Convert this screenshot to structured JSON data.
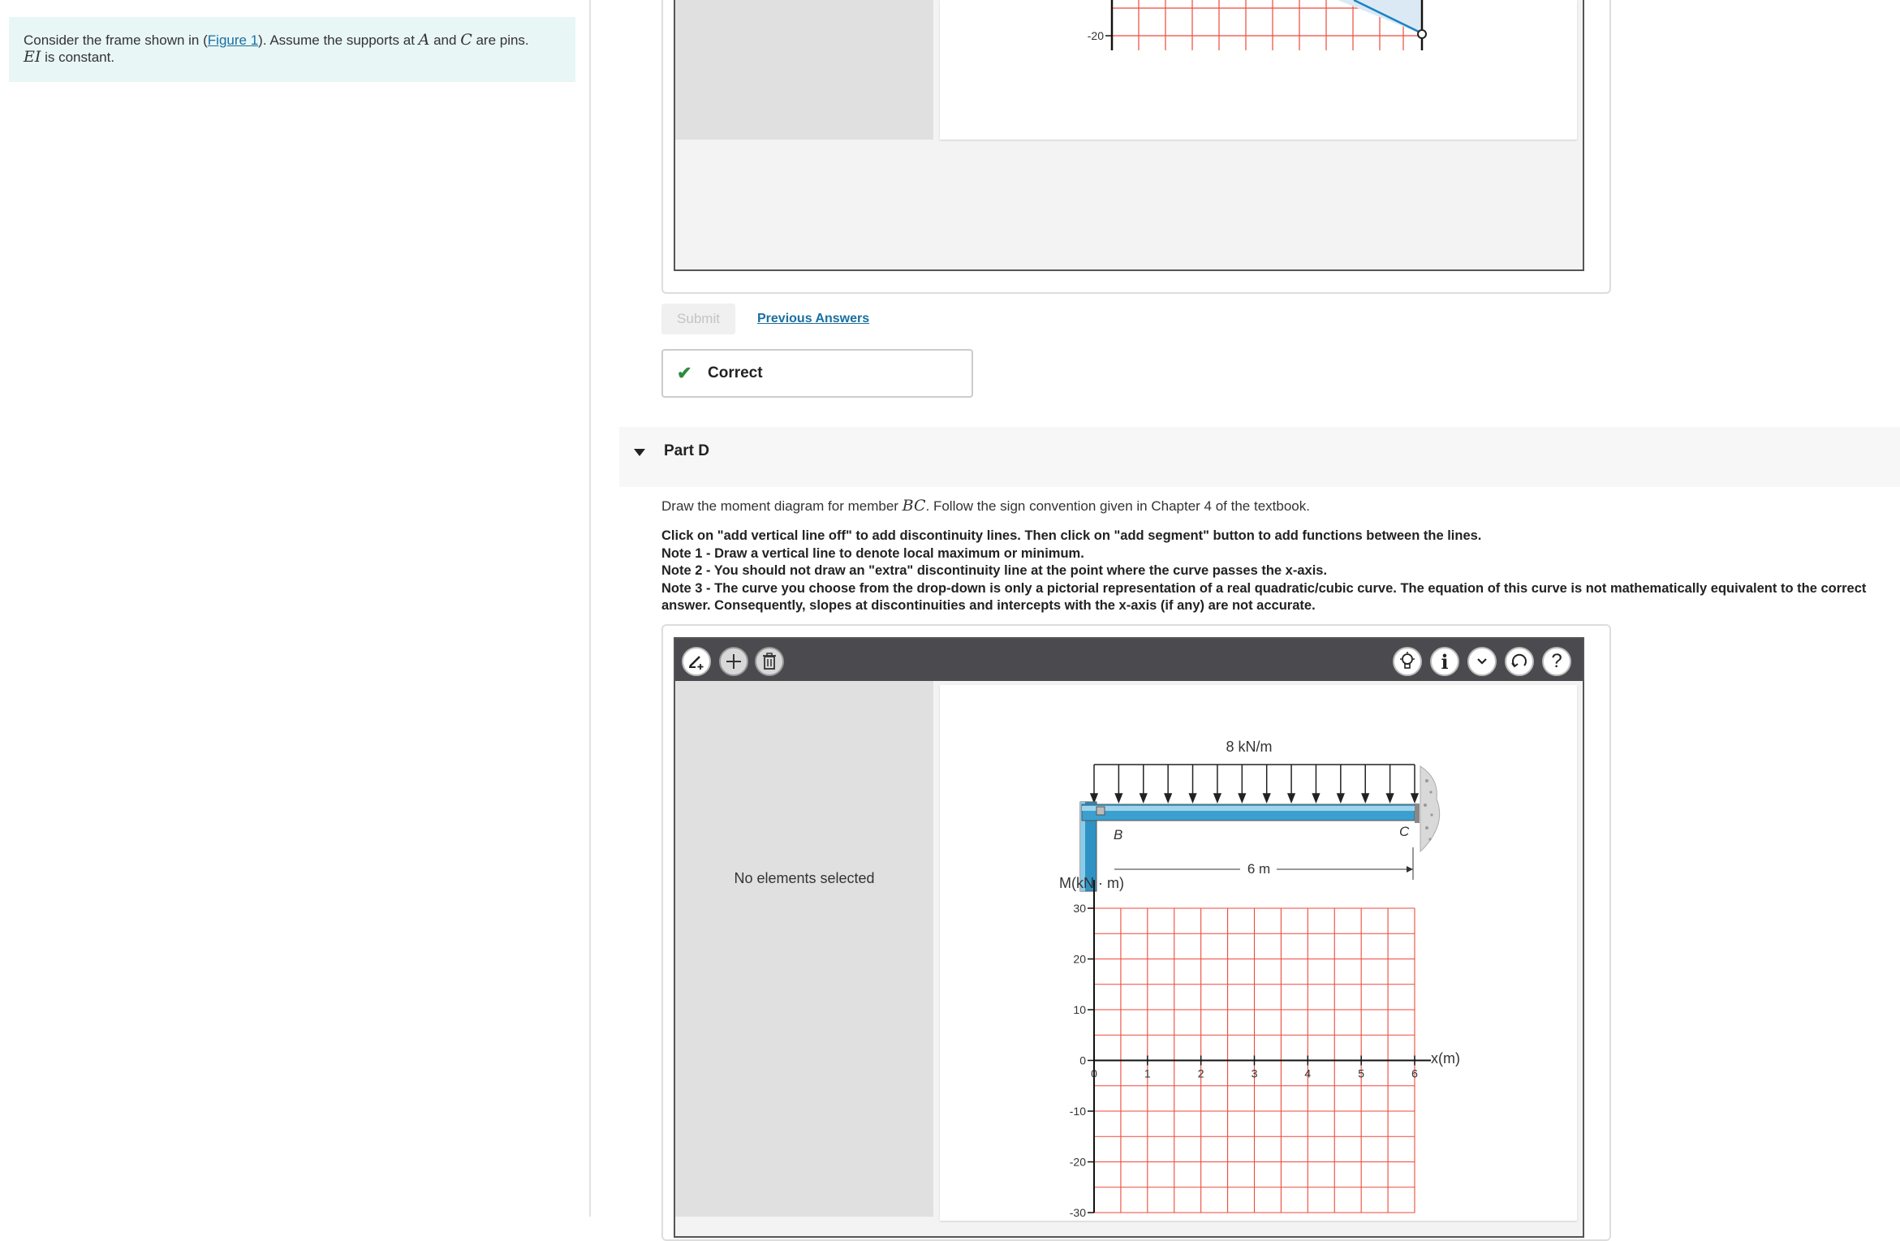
{
  "problem": {
    "text_before": "Consider the frame shown in (",
    "figure_link": "Figure 1",
    "text_mid": "). Assume the supports at ",
    "var_a": "A",
    "text_and": " and ",
    "var_c": "C",
    "text_after": " are pins.",
    "var_ei": "EI",
    "text_const": " is constant."
  },
  "top_graph": {
    "tick_label": "-20"
  },
  "actions": {
    "submit_label": "Submit",
    "previous_answers_label": "Previous Answers"
  },
  "feedback": {
    "label": "Correct"
  },
  "part_d": {
    "title": "Part D",
    "instruction_before": "Draw the moment diagram for member ",
    "member": "BC",
    "instruction_after": ". Follow the sign convention given in Chapter 4 of the textbook.",
    "notes": [
      "Click on \"add vertical line off\" to add discontinuity lines. Then click on \"add segment\" button to add functions between the lines.",
      "Note 1 - Draw a vertical line to denote local maximum or minimum.",
      "Note 2 - You should not draw an \"extra\" discontinuity line at the point where the curve passes the x-axis.",
      "Note 3 - The curve you choose from the drop-down is only a pictorial representation of a real quadratic/cubic curve. The equation of this curve is not mathematically equivalent to the correct answer. Consequently, slopes at discontinuities and intercepts with the x-axis (if any) are not accurate."
    ]
  },
  "toolbar": {
    "left_icons": [
      "add-vertical-line-icon",
      "add-segment-icon",
      "delete-icon"
    ],
    "right_icons": [
      "hint-bulb-icon",
      "info-icon",
      "dropdown-chevron-icon",
      "reset-icon",
      "help-icon"
    ]
  },
  "side_panel": {
    "empty_label": "No elements selected"
  },
  "figure": {
    "load_label": "8 kN/m",
    "span_label": "6 m",
    "point_b": "B",
    "point_c": "C"
  },
  "chart_data": {
    "type": "line",
    "title": "",
    "ylabel": "M(kN · m)",
    "xlabel": "x(m)",
    "xlim": [
      0,
      6
    ],
    "ylim": [
      -30,
      30
    ],
    "x_ticks": [
      "0",
      "1",
      "2",
      "3",
      "4",
      "5",
      "6"
    ],
    "y_ticks": [
      "30",
      "20",
      "10",
      "0",
      "-10",
      "-20",
      "-30"
    ],
    "grid": true,
    "series": []
  }
}
